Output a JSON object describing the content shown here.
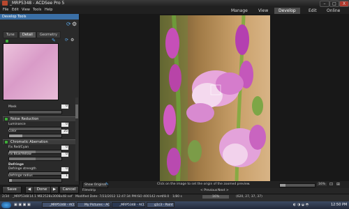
{
  "window": {
    "title": "_MRP5348 - ACDSee Pro 5",
    "min": "–",
    "max": "□",
    "close": "X"
  },
  "menu": [
    "File",
    "Edit",
    "View",
    "Tools",
    "Help"
  ],
  "modes": [
    {
      "label": "Manage",
      "active": false
    },
    {
      "label": "View",
      "active": false
    },
    {
      "label": "Develop",
      "active": true
    },
    {
      "label": "Edit",
      "active": false
    },
    {
      "label": "Online",
      "active": false
    }
  ],
  "panel": {
    "header": "Develop Tools",
    "subtabs": [
      {
        "label": "Tune",
        "active": false
      },
      {
        "label": "Detail",
        "active": true
      },
      {
        "label": "Geometry",
        "active": false
      }
    ],
    "mask_label": "Mask",
    "mask_value": "0",
    "noise_reduction": {
      "title": "Noise Reduction",
      "luminance_label": "Luminance",
      "luminance_value": "0",
      "luminance_frac": 0.0,
      "color_label": "Color",
      "color_value": "25",
      "color_frac": 0.25
    },
    "chromatic_aberration": {
      "title": "Chromatic Aberration",
      "red_cyan_label": "Fix Red/Cyan",
      "red_cyan_value": "0",
      "blue_yellow_label": "Fix Blue/Yellow",
      "blue_yellow_value": "0"
    },
    "defringe": {
      "title": "Defringe",
      "strength_label": "Defringe strength",
      "strength_value": "0",
      "radius_label": "Defringe radius",
      "radius_value": "1"
    },
    "save": "Save",
    "done": "Done",
    "cancel": "Cancel"
  },
  "viewer": {
    "show_original": "Show Original",
    "hint": "Click on the image to set the origin of the zoomed preview.",
    "zoom": "16%"
  },
  "filmstrip": {
    "label": "Filmstrip",
    "previous": "< Previous",
    "next": "Next >"
  },
  "infobar": {
    "index": "2/34",
    "filename": "_MRP5348",
    "size": "14.1 MB",
    "dims": "2528x3008x48 nef",
    "modified": "Modified Date: 7/23/2012 12:47:34 PM",
    "iso": "ISO 400",
    "focal": "142 mm",
    "aperture": "f/8.0",
    "shutter": "1/80 s",
    "zoom": "16%",
    "coords": "(620, 27, 37, 37)"
  },
  "taskbar": [
    "_MRP5348 - ACDSee ...",
    "My Pictures - ACDSee ...",
    "_MRP5348 - ACDSee ...",
    "g1c3 - Paint"
  ],
  "clock": "12:50 PM",
  "colors": {
    "accent": "#3a6fa6",
    "active_mode": "#4e4e4e",
    "checkbox": "#3fae3a"
  }
}
